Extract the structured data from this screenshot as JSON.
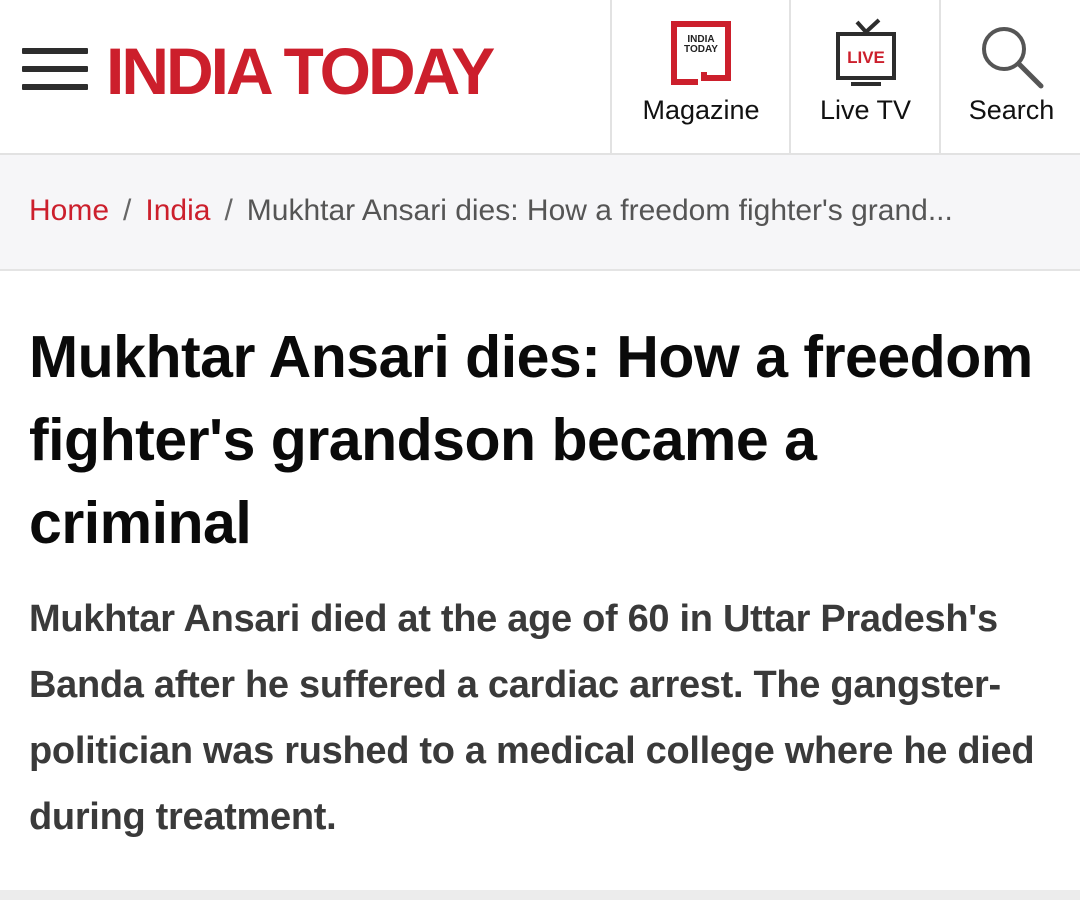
{
  "header": {
    "menu_icon": "hamburger-menu-icon",
    "logo_text": "INDIA TODAY",
    "brand_color": "#cc1f2c",
    "nav": {
      "magazine": {
        "label": "Magazine",
        "icon": "magazine-icon",
        "icon_text_1": "INDIA",
        "icon_text_2": "TODAY"
      },
      "live_tv": {
        "label": "Live TV",
        "icon": "live-tv-icon",
        "icon_text": "LIVE"
      },
      "search": {
        "label": "Search",
        "icon": "search-icon"
      }
    }
  },
  "breadcrumb": {
    "home": "Home",
    "section": "India",
    "separator": "/",
    "current": "Mukhtar Ansari dies: How a freedom fighter's grand..."
  },
  "article": {
    "headline": "Mukhtar Ansari dies: How a freedom fighter's grandson became a criminal",
    "summary": "Mukhtar Ansari died at the age of 60 in Uttar Pradesh's Banda after he suffered a cardiac arrest. The gangster-politician was rushed to a medical college where he died during treatment."
  }
}
